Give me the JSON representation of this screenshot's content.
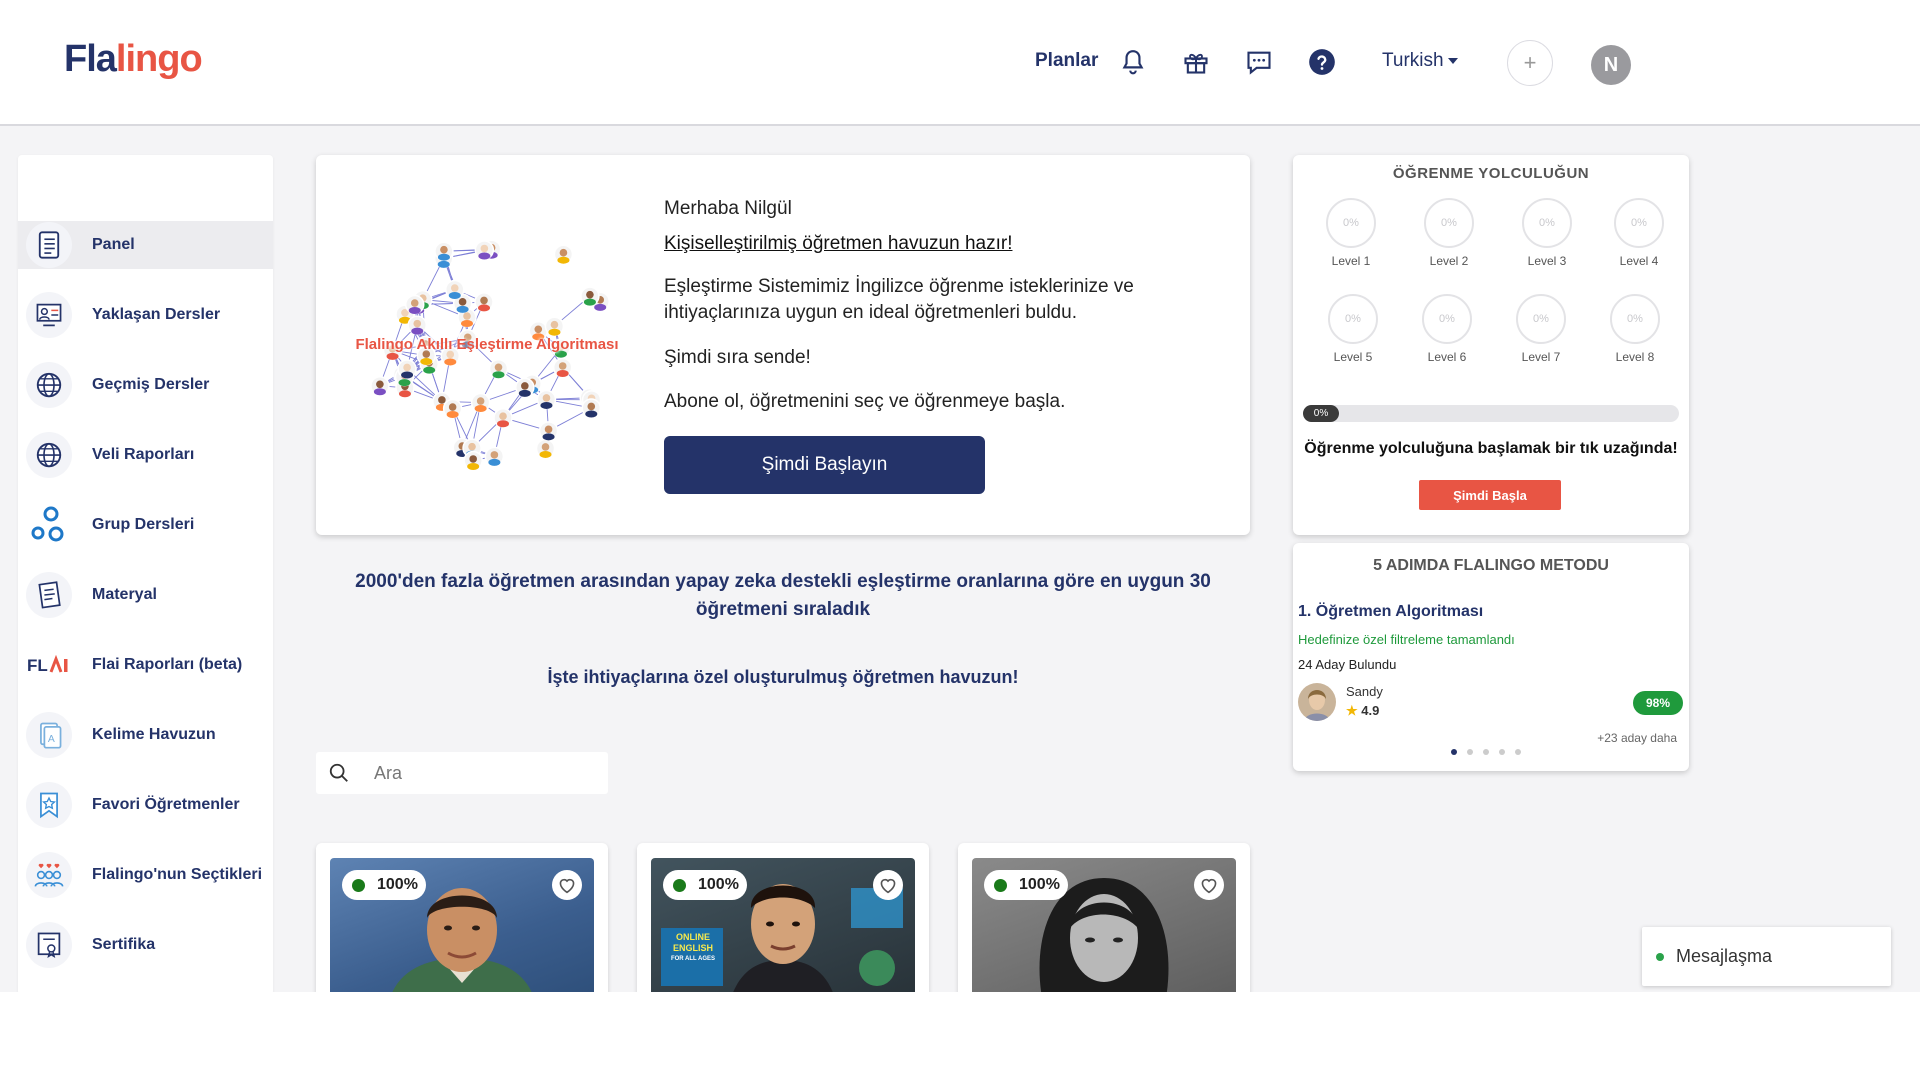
{
  "header": {
    "logo_part1": "Fla",
    "logo_part2": "lingo",
    "plans_link": "Planlar",
    "language": "Turkish",
    "plus_label": "+",
    "avatar_initial": "N"
  },
  "sidebar": {
    "items": [
      {
        "label": "Panel",
        "icon": "panel-icon"
      },
      {
        "label": "Yaklaşan Dersler",
        "icon": "upcoming-lessons-icon"
      },
      {
        "label": "Geçmiş Dersler",
        "icon": "globe-icon"
      },
      {
        "label": "Veli Raporları",
        "icon": "globe-icon"
      },
      {
        "label": "Grup Dersleri",
        "icon": "group-circles-icon"
      },
      {
        "label": "Materyal",
        "icon": "document-icon"
      },
      {
        "label": "Flai Raporları (beta)",
        "icon": "flai-logo-icon"
      },
      {
        "label": "Kelime Havuzun",
        "icon": "vocabulary-icon"
      },
      {
        "label": "Favori Öğretmenler",
        "icon": "favorite-badge-icon"
      },
      {
        "label": "Flalingo'nun Seçtikleri",
        "icon": "team-hearts-icon"
      },
      {
        "label": "Sertifika",
        "icon": "certificate-icon"
      }
    ]
  },
  "welcome": {
    "network_caption": "Flalingo Akıllı Eşleştirme Algoritması",
    "hello": "Merhaba Nilgül",
    "title": "Kişiselleştirilmiş öğretmen havuzun hazır!",
    "paragraph1": "Eşleştirme Sistemimiz İngilizce öğrenme isteklerinize ve ihtiyaçlarınıza uygun en ideal öğretmenleri buldu.",
    "paragraph2": "Şimdi sıra sende!",
    "paragraph3": "Abone ol, öğretmenini seç ve öğrenmeye başla.",
    "button": "Şimdi Başlayın"
  },
  "info": {
    "line1": "2000'den fazla öğretmen arasından yapay zeka destekli eşleştirme oranlarına göre en uygun 30 öğretmeni sıraladık",
    "line2": "İşte ihtiyaçlarına özel oluşturulmuş öğretmen havuzun!"
  },
  "search": {
    "placeholder": "Ara",
    "value": ""
  },
  "teachers": [
    {
      "match": "100%",
      "match_value": 100
    },
    {
      "match": "100%",
      "match_value": 100,
      "photo_text1": "ONLINE",
      "photo_text2": "ENGLISH",
      "photo_text3": "FOR ALL AGES"
    },
    {
      "match": "100%",
      "match_value": 100
    }
  ],
  "journey": {
    "title": "ÖĞRENME YOLCULUĞUN",
    "levels": [
      {
        "pct": "0%",
        "label": "Level 1"
      },
      {
        "pct": "0%",
        "label": "Level 2"
      },
      {
        "pct": "0%",
        "label": "Level 3"
      },
      {
        "pct": "0%",
        "label": "Level 4"
      },
      {
        "pct": "0%",
        "label": "Level 5"
      },
      {
        "pct": "0%",
        "label": "Level 6"
      },
      {
        "pct": "0%",
        "label": "Level 7"
      },
      {
        "pct": "0%",
        "label": "Level 8"
      }
    ],
    "progress_label": "0%",
    "progress_value": 0,
    "message": "Öğrenme yolculuğuna başlamak bir tık uzağında!",
    "button": "Şimdi Başla"
  },
  "method": {
    "title": "5 ADIMDA FLALINGO METODU",
    "step": "1. Öğretmen Algoritması",
    "sub": "Hedefinize özel filtreleme tamamlandı",
    "count": "24 Aday Bulundu",
    "teacher_name": "Sandy",
    "star": "★",
    "rating": "4.9",
    "match": "98%",
    "more": "+23 aday daha",
    "active_slide": 1,
    "slides": 5
  },
  "chat": {
    "label": "Mesajlaşma"
  },
  "colors": {
    "brand_navy": "#243369",
    "brand_red": "#e85544",
    "success_green": "#1f9a3c",
    "online_dot": "#1a7a1a"
  }
}
